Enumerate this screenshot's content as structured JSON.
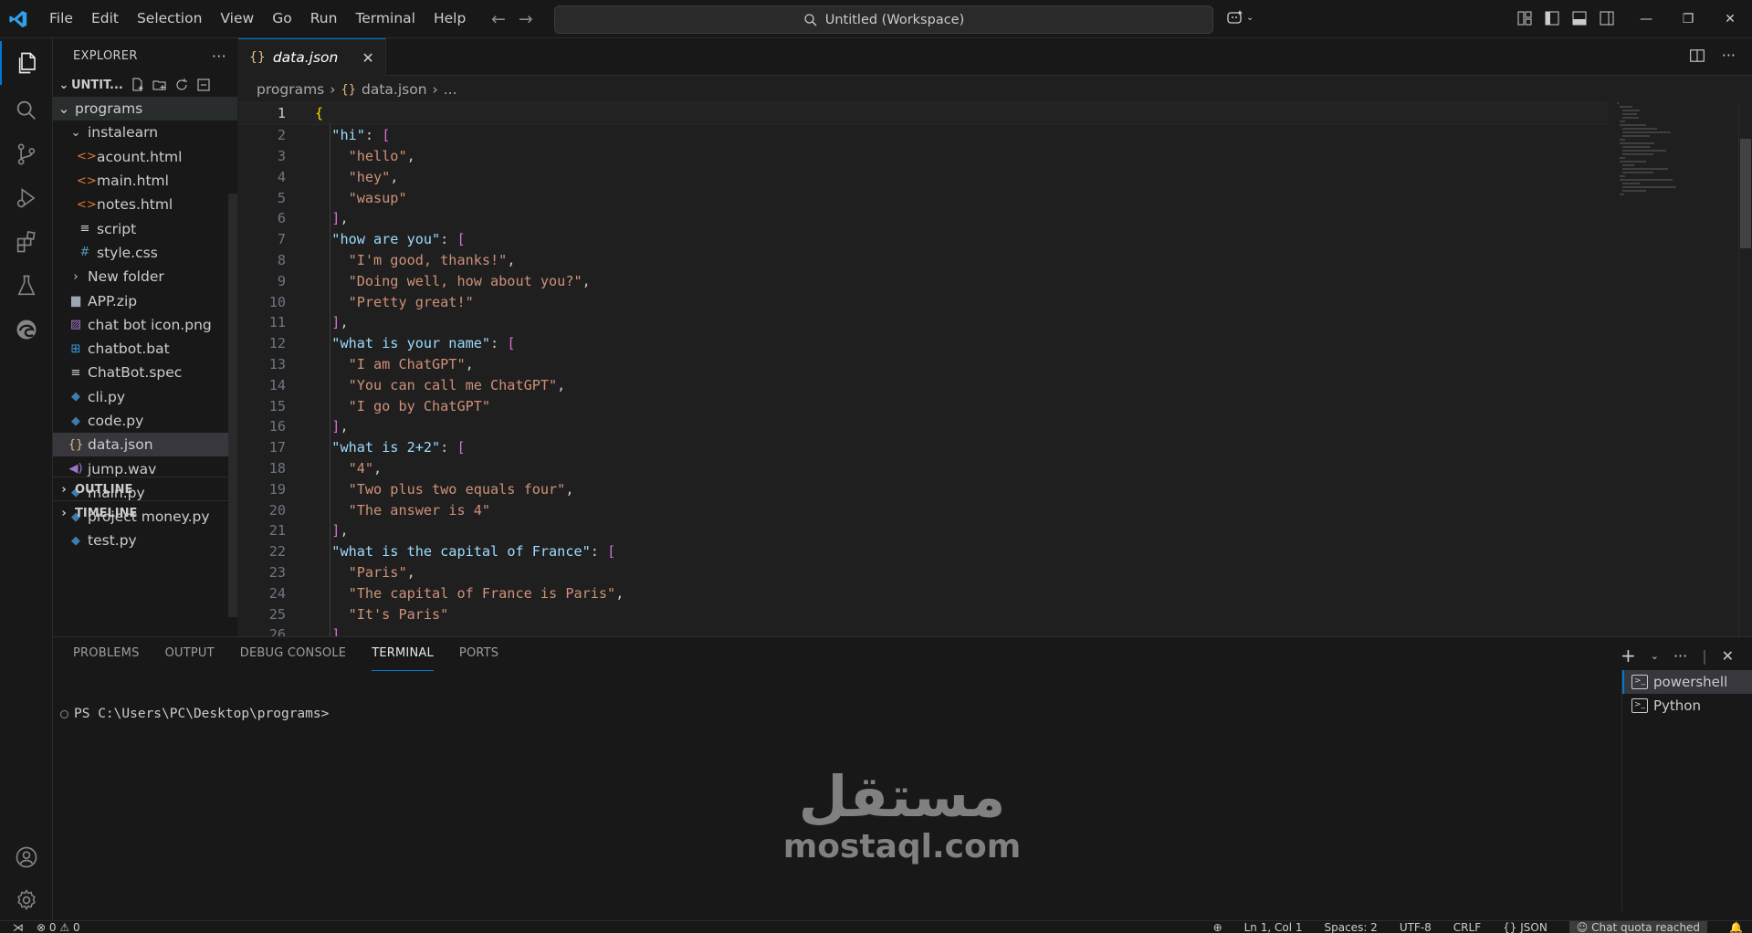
{
  "titlebar": {
    "menu": [
      "File",
      "Edit",
      "Selection",
      "View",
      "Go",
      "Run",
      "Terminal",
      "Help"
    ],
    "command_center": "Untitled (Workspace)"
  },
  "explorer": {
    "header": "EXPLORER",
    "workspace": "UNTIT...",
    "root_folder": "programs",
    "items": [
      {
        "label": "instalearn",
        "icon": "chevron-down-icon",
        "indent": 1
      },
      {
        "label": "acount.html",
        "icon": "html-file-icon",
        "indent": 2
      },
      {
        "label": "main.html",
        "icon": "html-file-icon",
        "indent": 2
      },
      {
        "label": "notes.html",
        "icon": "html-file-icon",
        "indent": 2
      },
      {
        "label": "script",
        "icon": "text-file-icon",
        "indent": 2
      },
      {
        "label": "style.css",
        "icon": "css-file-icon",
        "indent": 2
      },
      {
        "label": "New folder",
        "icon": "chevron-right-icon",
        "indent": 1
      },
      {
        "label": "APP.zip",
        "icon": "zip-file-icon",
        "indent": 1
      },
      {
        "label": "chat bot icon.png",
        "icon": "image-file-icon",
        "indent": 1
      },
      {
        "label": "chatbot.bat",
        "icon": "windows-file-icon",
        "indent": 1
      },
      {
        "label": "ChatBot.spec",
        "icon": "text-file-icon",
        "indent": 1
      },
      {
        "label": "cli.py",
        "icon": "python-file-icon",
        "indent": 1
      },
      {
        "label": "code.py",
        "icon": "python-file-icon",
        "indent": 1
      },
      {
        "label": "data.json",
        "icon": "json-file-icon",
        "indent": 1,
        "selected": true
      },
      {
        "label": "jump.wav",
        "icon": "audio-file-icon",
        "indent": 1
      },
      {
        "label": "main.py",
        "icon": "python-file-icon",
        "indent": 1
      },
      {
        "label": "project money.py",
        "icon": "python-file-icon",
        "indent": 1
      },
      {
        "label": "test.py",
        "icon": "python-file-icon",
        "indent": 1
      }
    ],
    "outline": "OUTLINE",
    "timeline": "TIMELINE"
  },
  "editor": {
    "tab_label": "data.json",
    "tab_icon": "{}",
    "breadcrumb": [
      "programs",
      "data.json",
      "..."
    ],
    "lines": [
      "{",
      "  \"hi\": [",
      "    \"hello\",",
      "    \"hey\",",
      "    \"wasup\"",
      "  ],",
      "  \"how are you\": [",
      "    \"I'm good, thanks!\",",
      "    \"Doing well, how about you?\",",
      "    \"Pretty great!\"",
      "  ],",
      "  \"what is your name\": [",
      "    \"I am ChatGPT\",",
      "    \"You can call me ChatGPT\",",
      "    \"I go by ChatGPT\"",
      "  ],",
      "  \"what is 2+2\": [",
      "    \"4\",",
      "    \"Two plus two equals four\",",
      "    \"The answer is 4\"",
      "  ],",
      "  \"what is the capital of France\": [",
      "    \"Paris\",",
      "    \"The capital of France is Paris\",",
      "    \"It's Paris\"",
      "  ]"
    ]
  },
  "panel": {
    "tabs": [
      "PROBLEMS",
      "OUTPUT",
      "DEBUG CONSOLE",
      "TERMINAL",
      "PORTS"
    ],
    "active_tab": "TERMINAL",
    "prompt": "PS C:\\Users\\PC\\Desktop\\programs>",
    "terminals": [
      "powershell",
      "Python"
    ]
  },
  "watermark": {
    "arabic": "مستقل",
    "latin": "mostaql.com"
  },
  "statusbar": {
    "errors": "0",
    "warnings": "0",
    "cursor": "Ln 1, Col 1",
    "spaces": "Spaces: 2",
    "encoding": "UTF-8",
    "eol": "CRLF",
    "language": "JSON",
    "chat_quota": "Chat quota reached"
  },
  "colors": {
    "accent": "#0078d4",
    "json_key": "#9cdcfe",
    "json_string": "#ce9178",
    "bracket_gold": "#ffd700",
    "bracket_purple": "#da70d6"
  }
}
